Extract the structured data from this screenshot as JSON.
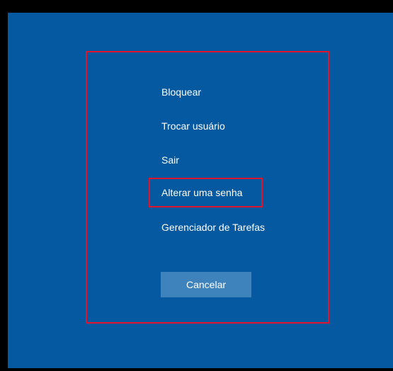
{
  "menu": {
    "items": [
      {
        "label": "Bloquear"
      },
      {
        "label": "Trocar usuário"
      },
      {
        "label": "Sair"
      },
      {
        "label": "Alterar uma senha"
      },
      {
        "label": "Gerenciador de Tarefas"
      }
    ]
  },
  "cancel": {
    "label": "Cancelar"
  },
  "colors": {
    "background": "#0459a0",
    "button": "#3f83bd",
    "annotation": "#e0142b",
    "text": "#ffffff"
  }
}
